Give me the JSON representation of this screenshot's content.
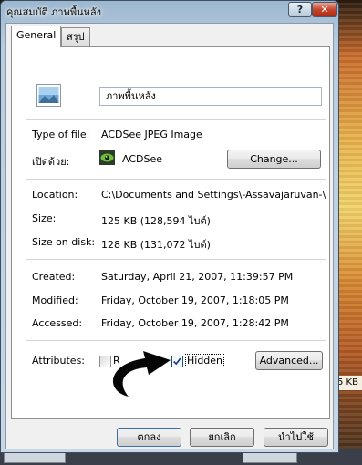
{
  "window": {
    "title": "คุณสมบัติ ภาพพื้นหลัง",
    "help_glyph": "?",
    "close_glyph": "✕"
  },
  "tabs": [
    {
      "label": "General",
      "active": true
    },
    {
      "label": "สรุป",
      "active": false
    }
  ],
  "file": {
    "name": "ภาพพื้นหลัง",
    "icon": "image-file-icon"
  },
  "type_of_file": {
    "label": "Type of file:",
    "value": "ACDSee JPEG Image"
  },
  "opens_with": {
    "label": "เปิดด้วย:",
    "value": "ACDSee",
    "icon": "acdsee-eye-icon",
    "button": "Change..."
  },
  "location": {
    "label": "Location:",
    "value": "C:\\Documents and Settings\\-Assavajaruvan-\\My D"
  },
  "size": {
    "label": "Size:",
    "value": "125 KB (128,594 ไบต์)"
  },
  "size_on_disk": {
    "label": "Size on disk:",
    "value": "128 KB (131,072 ไบต์)"
  },
  "created": {
    "label": "Created:",
    "value": "Saturday, April 21, 2007, 11:39:57 PM"
  },
  "modified": {
    "label": "Modified:",
    "value": "Friday, October 19, 2007, 1:18:05 PM"
  },
  "accessed": {
    "label": "Accessed:",
    "value": "Friday, October 19, 2007, 1:28:42 PM"
  },
  "attributes": {
    "label": "Attributes:",
    "readonly": {
      "label": "R",
      "checked": false
    },
    "hidden": {
      "label": "Hidden",
      "checked": true
    },
    "advanced_button": "Advanced..."
  },
  "buttons": {
    "ok": "ตกลง",
    "cancel": "ยกเลิก",
    "apply": "นำไปใช้"
  },
  "background": {
    "size_fragment": "5 KB"
  },
  "colors": {
    "title_bar": "#b9cde0",
    "close_button": "#c5442c",
    "panel": "#ffffff"
  }
}
